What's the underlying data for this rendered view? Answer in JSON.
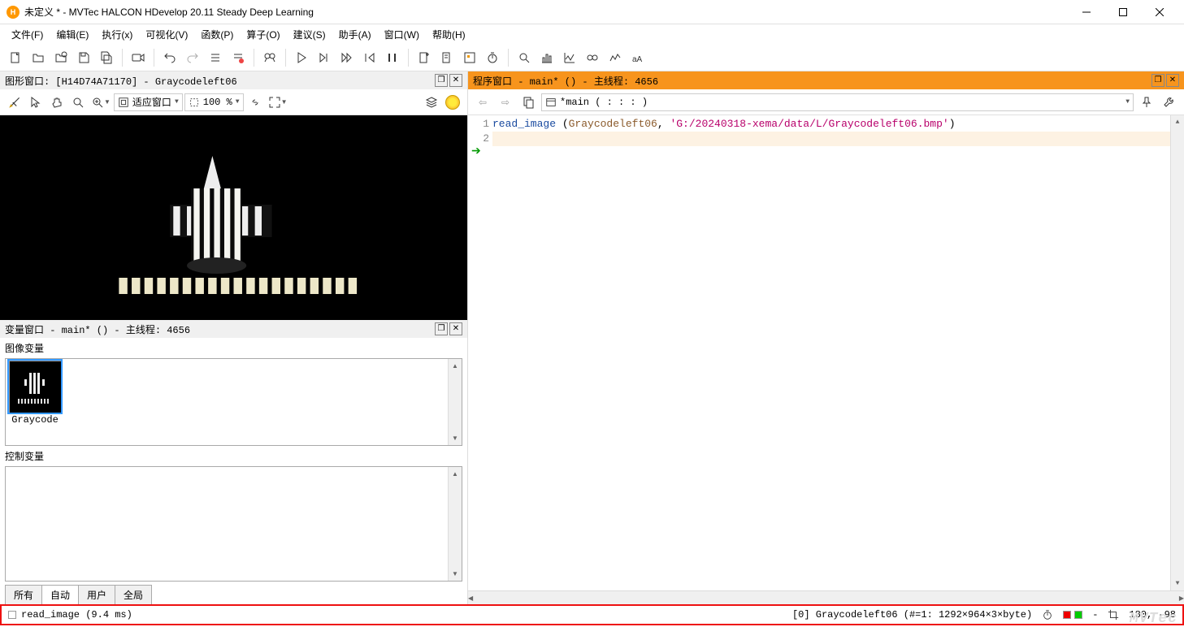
{
  "window": {
    "title": "未定义 * - MVTec HALCON HDevelop 20.11 Steady Deep Learning"
  },
  "menu": {
    "file": "文件(F)",
    "edit": "编辑(E)",
    "exec": "执行(x)",
    "vis": "可视化(V)",
    "func": "函数(P)",
    "op": "算子(O)",
    "sugg": "建议(S)",
    "asst": "助手(A)",
    "win": "窗口(W)",
    "help": "帮助(H)"
  },
  "graphics_panel": {
    "title": "图形窗口: [H14D74A71170] - Graycodeleft06",
    "fit_label": "适应窗口",
    "zoom_value": "100 %"
  },
  "var_panel": {
    "title": "变量窗口 - main* () - 主线程: 4656",
    "image_vars_label": "图像变量",
    "ctrl_vars_label": "控制变量",
    "thumb_name": "Graycode",
    "tabs": {
      "all": "所有",
      "auto": "自动",
      "user": "用户",
      "global": "全局"
    }
  },
  "program_panel": {
    "title": "程序窗口 - main* () - 主线程: 4656",
    "proc_selector": "*main ( : : : )"
  },
  "code": {
    "l1_fn": "read_image",
    "l1_open": " (",
    "l1_var": "Graycodeleft06",
    "l1_comma": ", ",
    "l1_str": "'G:/20240318-xema/data/L/Graycodeleft06.bmp'",
    "l1_close": ")"
  },
  "status": {
    "left": "read_image (9.4 ms)",
    "mid": "[0] Graycodeleft06 (#=1: 1292×964×3×byte)",
    "dash": "-",
    "coords": "180, -98"
  }
}
